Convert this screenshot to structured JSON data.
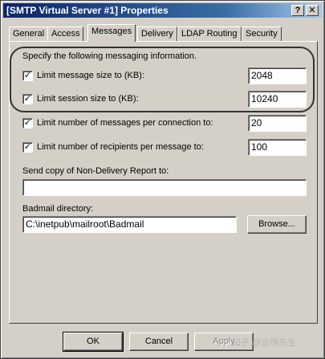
{
  "window": {
    "title": "[SMTP Virtual Server #1] Properties",
    "help_glyph": "?",
    "close_glyph": "✕"
  },
  "tabs": [
    "General",
    "Access",
    "Messages",
    "Delivery",
    "LDAP Routing",
    "Security"
  ],
  "active_tab": "Messages",
  "messages": {
    "intro": "Specify the following messaging information.",
    "check_glyph": "✓",
    "limit_message_size": {
      "label": "Limit message size to (KB):",
      "checked": true,
      "value": "2048"
    },
    "limit_session_size": {
      "label": "Limit session size to (KB):",
      "checked": true,
      "value": "10240"
    },
    "limit_messages_per_connection": {
      "label": "Limit number of messages per connection to:",
      "checked": true,
      "value": "20"
    },
    "limit_recipients_per_message": {
      "label": "Limit number of recipients per message to:",
      "checked": true,
      "value": "100"
    },
    "ndr_copy_label": "Send copy of Non-Delivery Report to:",
    "ndr_copy_value": "",
    "badmail_label": "Badmail directory:",
    "badmail_value": "C:\\inetpub\\mailroot\\Badmail",
    "browse_label": "Browse..."
  },
  "footer": {
    "ok_label": "OK",
    "cancel_label": "Cancel",
    "apply_label": "Apply"
  },
  "watermark": "知乎 @运维先生"
}
